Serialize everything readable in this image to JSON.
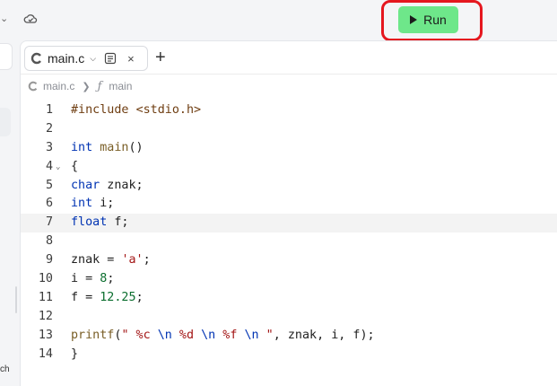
{
  "toolbar": {
    "run_label": "Run"
  },
  "left_panel": {
    "truncated_text": "ch"
  },
  "tab": {
    "filename": "main.c",
    "add_label": "+",
    "close_label": "×"
  },
  "breadcrumb": {
    "file": "main.c",
    "function_symbol": "ƒ",
    "function": "main"
  },
  "editor": {
    "active_line": 7,
    "lines": [
      {
        "num": "1",
        "tokens": [
          {
            "t": "#include ",
            "c": "inc"
          },
          {
            "t": "<stdio.h>",
            "c": "inc"
          }
        ]
      },
      {
        "num": "2",
        "tokens": []
      },
      {
        "num": "3",
        "tokens": [
          {
            "t": "int",
            "c": "kw"
          },
          {
            "t": " "
          },
          {
            "t": "main",
            "c": "fn"
          },
          {
            "t": "()"
          }
        ]
      },
      {
        "num": "4",
        "fold": true,
        "tokens": [
          {
            "t": "{"
          }
        ]
      },
      {
        "num": "5",
        "tokens": [
          {
            "t": "char",
            "c": "kw"
          },
          {
            "t": " znak;"
          }
        ]
      },
      {
        "num": "6",
        "tokens": [
          {
            "t": "int",
            "c": "kw"
          },
          {
            "t": " i;"
          }
        ]
      },
      {
        "num": "7",
        "tokens": [
          {
            "t": "float",
            "c": "kw"
          },
          {
            "t": " f;"
          }
        ]
      },
      {
        "num": "8",
        "tokens": []
      },
      {
        "num": "9",
        "tokens": [
          {
            "t": "znak = "
          },
          {
            "t": "'a'",
            "c": "str"
          },
          {
            "t": ";"
          }
        ]
      },
      {
        "num": "10",
        "tokens": [
          {
            "t": "i = "
          },
          {
            "t": "8",
            "c": "num"
          },
          {
            "t": ";"
          }
        ]
      },
      {
        "num": "11",
        "tokens": [
          {
            "t": "f = "
          },
          {
            "t": "12.25",
            "c": "num"
          },
          {
            "t": ";"
          }
        ]
      },
      {
        "num": "12",
        "tokens": []
      },
      {
        "num": "13",
        "tokens": [
          {
            "t": "printf",
            "c": "fn"
          },
          {
            "t": "("
          },
          {
            "t": "\" %c ",
            "c": "str"
          },
          {
            "t": "\\n",
            "c": "esc"
          },
          {
            "t": " %d ",
            "c": "str"
          },
          {
            "t": "\\n",
            "c": "esc"
          },
          {
            "t": " %f ",
            "c": "str"
          },
          {
            "t": "\\n",
            "c": "esc"
          },
          {
            "t": " \"",
            "c": "str"
          },
          {
            "t": ", znak, i, f);"
          }
        ]
      },
      {
        "num": "14",
        "tokens": [
          {
            "t": "}"
          }
        ]
      }
    ]
  },
  "colors": {
    "run_button": "#6ee78a",
    "highlight_box": "#e5171f",
    "keyword": "#0033b3",
    "string": "#a31515",
    "number": "#0b6e2e"
  }
}
